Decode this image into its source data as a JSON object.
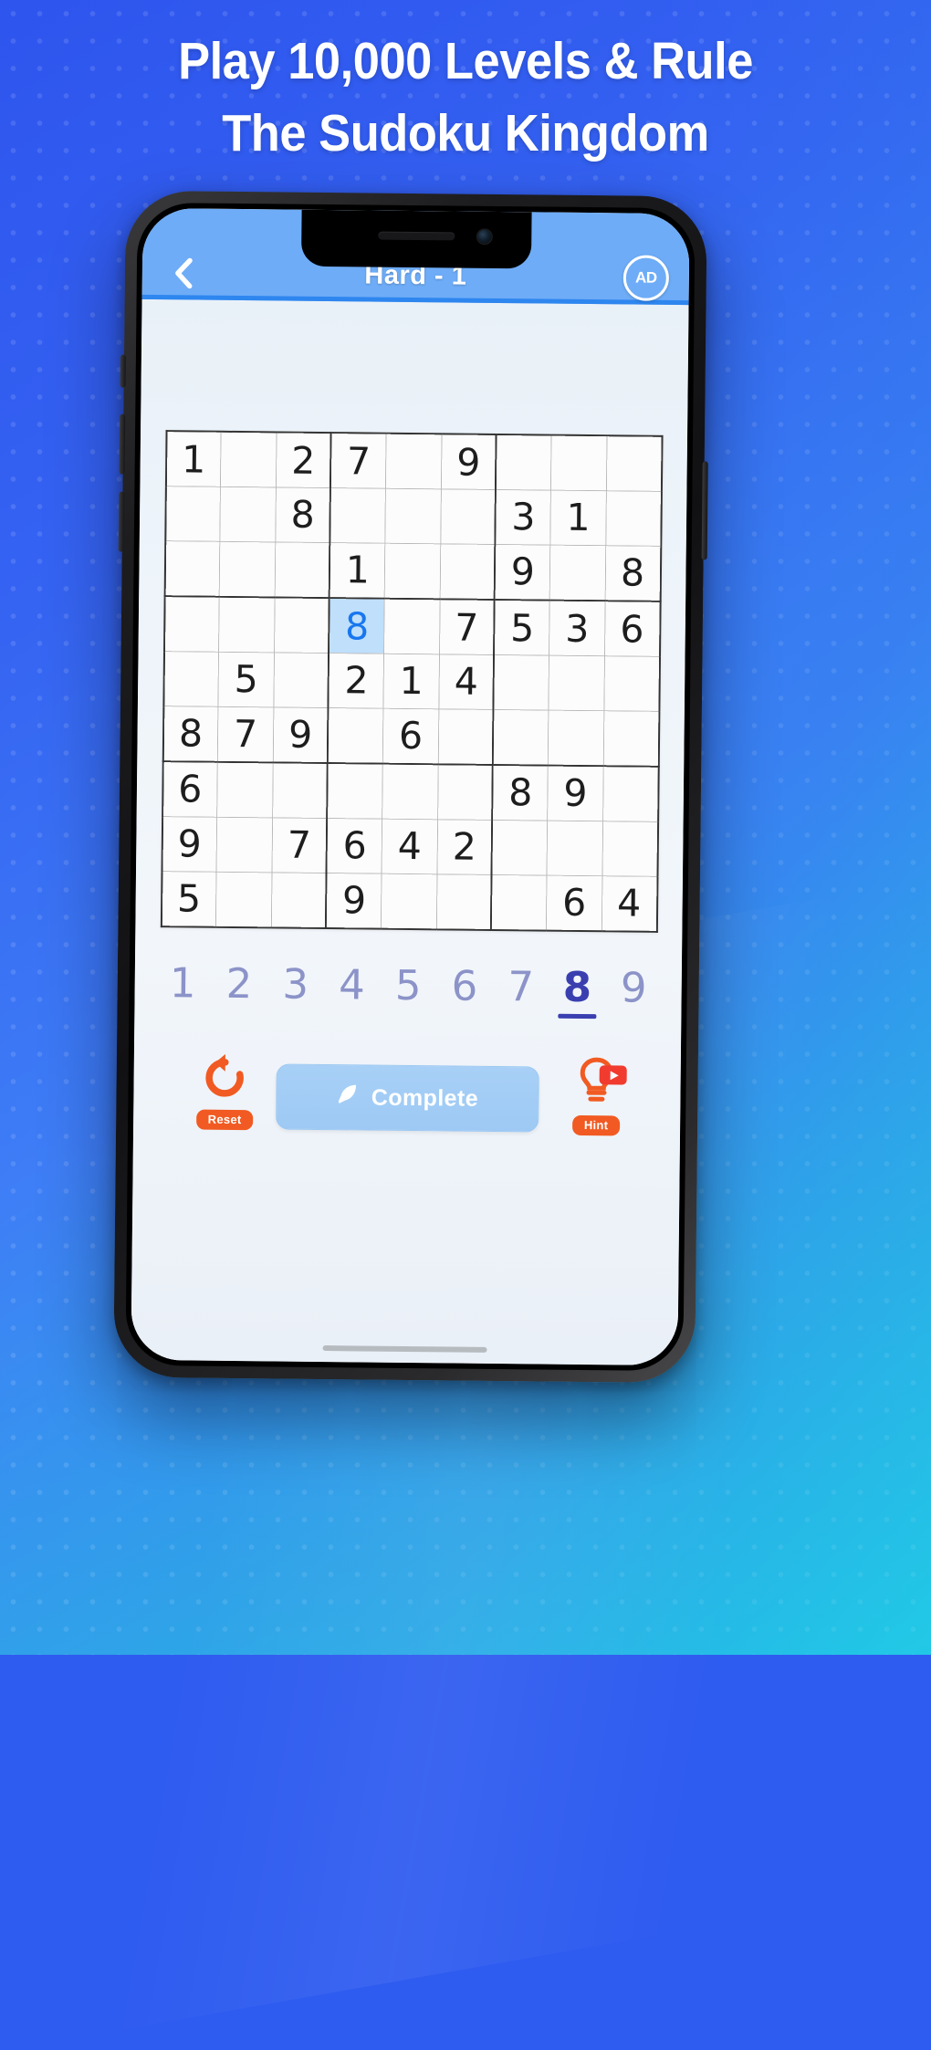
{
  "headline": {
    "line1": "Play 10,000 Levels & Rule",
    "line2": "The Sudoku Kingdom"
  },
  "appbar": {
    "back_icon": "chevron-left-icon",
    "title": "Hard - 1",
    "ad_label": "AD",
    "bar_color": "#6eacf7",
    "underline_color": "#2e86ef"
  },
  "board": {
    "selected_row": 3,
    "selected_col": 3,
    "selected_value": "8",
    "selected_color": "#1877ef",
    "highlight_color": "#bfdffb",
    "rows": [
      [
        "1",
        "",
        "2",
        "7",
        "",
        "9",
        "",
        "",
        ""
      ],
      [
        "",
        "",
        "8",
        "",
        "",
        "",
        "3",
        "1",
        ""
      ],
      [
        "",
        "",
        "",
        "1",
        "",
        "",
        "9",
        "",
        "8"
      ],
      [
        "",
        "",
        "",
        "8",
        "",
        "7",
        "5",
        "3",
        "6"
      ],
      [
        "",
        "5",
        "",
        "2",
        "1",
        "4",
        "",
        "",
        ""
      ],
      [
        "8",
        "7",
        "9",
        "",
        "6",
        "",
        "",
        "",
        ""
      ],
      [
        "6",
        "",
        "",
        "",
        "",
        "",
        "8",
        "9",
        ""
      ],
      [
        "9",
        "",
        "7",
        "6",
        "4",
        "2",
        "",
        "",
        ""
      ],
      [
        "5",
        "",
        "",
        "9",
        "",
        "",
        "",
        "6",
        "4"
      ]
    ]
  },
  "numpad": {
    "keys": [
      "1",
      "2",
      "3",
      "4",
      "5",
      "6",
      "7",
      "8",
      "9"
    ],
    "active": "8",
    "active_color": "#3a3fb0",
    "inactive_color": "#8c93c8"
  },
  "actions": {
    "reset_label": "Reset",
    "reset_icon": "undo-arrow-icon",
    "hint_label": "Hint",
    "hint_icon": "lightbulb-icon",
    "hint_video_icon": "play-video-icon",
    "complete_label": "Complete",
    "complete_icon": "feather-pen-icon",
    "accent_color": "#f15a22"
  }
}
